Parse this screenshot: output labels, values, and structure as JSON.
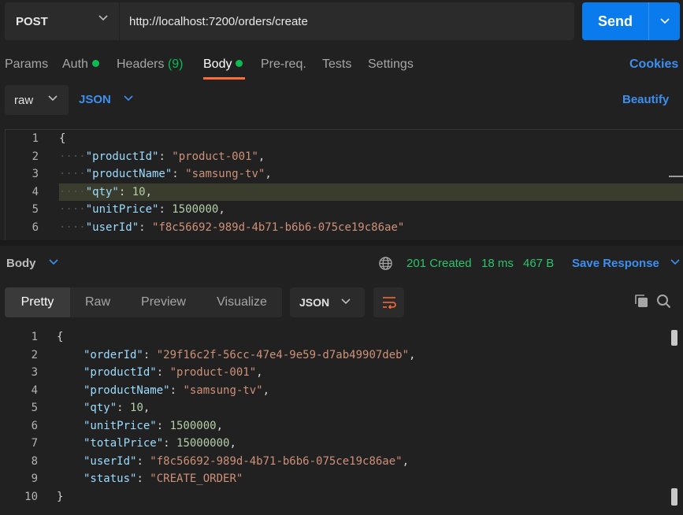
{
  "request": {
    "method": "POST",
    "url": "http://localhost:7200/orders/create",
    "send_label": "Send"
  },
  "tabs": {
    "params": "Params",
    "auth": "Auth",
    "headers": "Headers",
    "headers_count": "(9)",
    "body": "Body",
    "prereq": "Pre-req.",
    "tests": "Tests",
    "settings": "Settings",
    "cookies": "Cookies"
  },
  "body_options": {
    "mode": "raw",
    "language": "JSON",
    "beautify": "Beautify"
  },
  "request_body": {
    "line_numbers": [
      "1",
      "2",
      "3",
      "4",
      "5",
      "6"
    ],
    "highlighted_line": "4",
    "lines": [
      {
        "indent": "",
        "brace": "{"
      },
      {
        "indent": "····",
        "key": "\"productId\"",
        "value": "\"product-001\"",
        "value_type": "str",
        "comma": ","
      },
      {
        "indent": "····",
        "key": "\"productName\"",
        "value": "\"samsung-tv\"",
        "value_type": "str",
        "comma": ","
      },
      {
        "indent": "····",
        "key": "\"qty\"",
        "value": "10",
        "value_type": "num",
        "comma": ","
      },
      {
        "indent": "····",
        "key": "\"unitPrice\"",
        "value": "1500000",
        "value_type": "num",
        "comma": ","
      },
      {
        "indent": "····",
        "key": "\"userId\"",
        "value": "\"f8c56692-989d-4b71-b6b6-075ce19c86ae\"",
        "value_type": "str",
        "comma": ""
      }
    ]
  },
  "response": {
    "section_label": "Body",
    "status": "201 Created",
    "time": "18 ms",
    "size": "467 B",
    "save_label": "Save Response",
    "view_tabs": [
      "Pretty",
      "Raw",
      "Preview",
      "Visualize"
    ],
    "active_view": "Pretty",
    "format": "JSON",
    "line_numbers": [
      "1",
      "2",
      "3",
      "4",
      "5",
      "6",
      "7",
      "8",
      "9",
      "10"
    ],
    "lines": [
      {
        "brace": "{"
      },
      {
        "key": "\"orderId\"",
        "value": "\"29f16c2f-56cc-47e4-9e59-d7ab49907deb\"",
        "value_type": "str",
        "comma": ","
      },
      {
        "key": "\"productId\"",
        "value": "\"product-001\"",
        "value_type": "str",
        "comma": ","
      },
      {
        "key": "\"productName\"",
        "value": "\"samsung-tv\"",
        "value_type": "str",
        "comma": ","
      },
      {
        "key": "\"qty\"",
        "value": "10",
        "value_type": "num",
        "comma": ","
      },
      {
        "key": "\"unitPrice\"",
        "value": "1500000",
        "value_type": "num",
        "comma": ","
      },
      {
        "key": "\"totalPrice\"",
        "value": "15000000",
        "value_type": "num",
        "comma": ","
      },
      {
        "key": "\"userId\"",
        "value": "\"f8c56692-989d-4b71-b6b6-075ce19c86ae\"",
        "value_type": "str",
        "comma": ","
      },
      {
        "key": "\"status\"",
        "value": "\"CREATE_ORDER\"",
        "value_type": "str",
        "comma": ""
      },
      {
        "brace": "}"
      }
    ]
  },
  "colors": {
    "accent": "#ff6c37",
    "send": "#097bed",
    "link": "#3d8ff0",
    "success": "#2bc46a"
  }
}
